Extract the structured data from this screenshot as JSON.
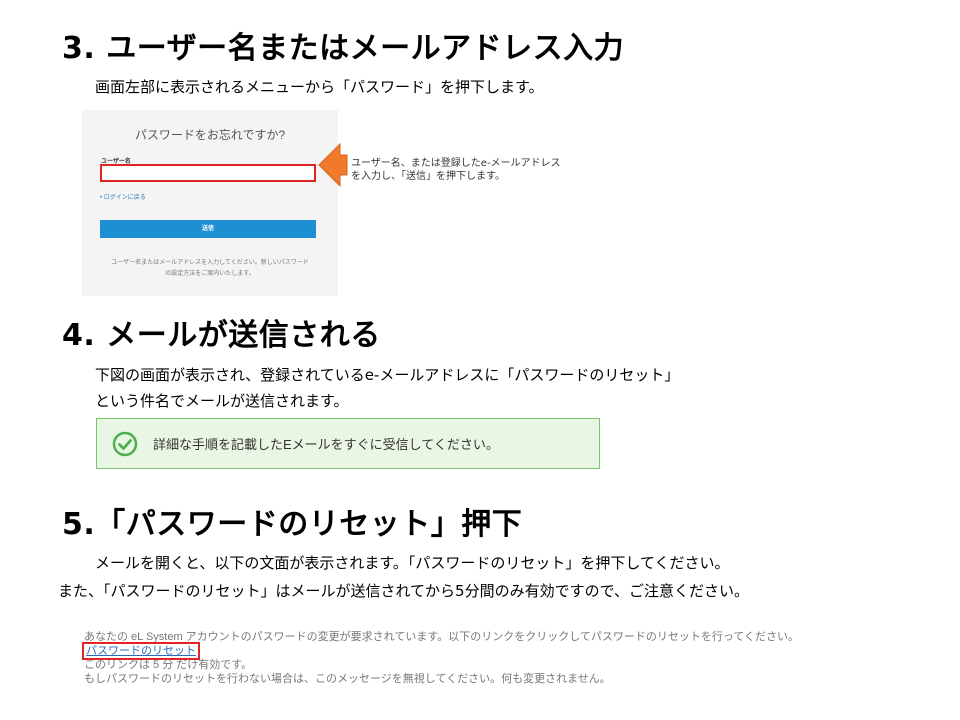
{
  "sections": [
    {
      "heading": "3. ユーザー名またはメールアドレス入力",
      "lines": [
        "画面左部に表示されるメニューから「パスワード」を押下します。"
      ]
    },
    {
      "heading": "4. メールが送信される",
      "lines": [
        "下図の画面が表示され、登録されているe-メールアドレスに「パスワードのリセット」",
        "という件名でメールが送信されます。"
      ]
    },
    {
      "heading": "5.「パスワードのリセット」押下",
      "lines": [
        "メールを開くと、以下の文面が表示されます。「パスワードのリセット」を押下してください。",
        "また、「パスワードのリセット」はメールが送信されてから5分間のみ有効ですので、ご注意ください。"
      ]
    }
  ],
  "login_form": {
    "title": "パスワードをお忘れですか?",
    "username_label": "ユーザー名",
    "back_link": "• ログインに戻る",
    "submit_label": "送信",
    "note": "ユーザー名またはメールアドレスを入力してください。新しいパスワード\nの設定方法をご案内いたします。"
  },
  "callout": {
    "text": "ユーザー名、または登録したe-メールアドレス\nを入力し、「送信」を押下します。"
  },
  "alert": {
    "text": "詳細な手順を記載したEメールをすぐに受信してください。",
    "icon": "check-circle-icon",
    "color": "#4caf50"
  },
  "email": {
    "line1": "あなたの eL System アカウントのパスワードの変更が要求されています。以下のリンクをクリックしてパスワードのリセットを行ってください。",
    "link": "パスワードのリセット",
    "line2": "このリンクは 5 分 だけ有効です。",
    "line3": "もしパスワードのリセットを行わない場合は、このメッセージを無視してください。何も変更されません。"
  },
  "colors": {
    "highlight": "#e02424",
    "callout_arrow": "#f07a2c",
    "button": "#1e8fd2"
  }
}
